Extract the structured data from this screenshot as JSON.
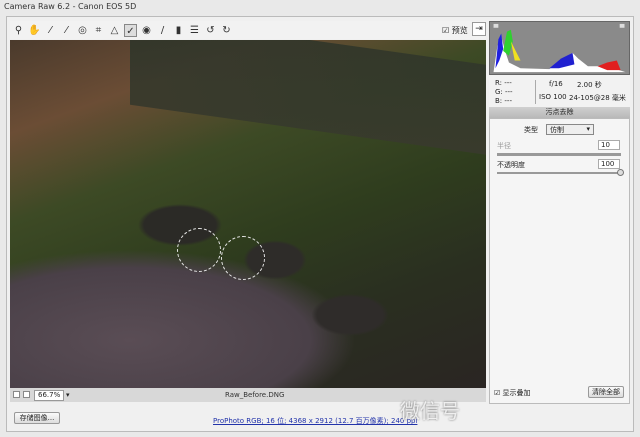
{
  "window": {
    "title": "Camera Raw 6.2 - Canon EOS 5D"
  },
  "toolbar": {
    "tools": [
      "zoom-icon",
      "hand-icon",
      "white-balance-icon",
      "color-sampler-icon",
      "target-adjust-icon",
      "crop-icon",
      "straighten-icon",
      "spot-removal-icon",
      "red-eye-icon",
      "adjustment-brush-icon",
      "graduated-filter-icon",
      "preferences-icon",
      "rotate-ccw-icon",
      "rotate-cw-icon"
    ],
    "active_tool": "spot-removal-icon",
    "preview_label": "预览",
    "preview_checked": true
  },
  "info": {
    "r": "R: ---",
    "g": "G: ---",
    "b": "B: ---",
    "aperture": "f/16",
    "shutter": "2.00 秒",
    "iso": "ISO 100",
    "lens": "24-105@28 毫米"
  },
  "panel": {
    "title": "污点去除",
    "type_label": "类型",
    "type_value": "仿制",
    "radius_label": "半径",
    "radius_value": "10",
    "opacity_label": "不透明度",
    "opacity_value": "100",
    "radius_fraction": 0.1,
    "opacity_fraction": 1.0,
    "overlay_label": "显示叠加",
    "overlay_checked": true,
    "clear_all": "清除全部"
  },
  "status": {
    "zoom": "66.7%",
    "filename": "Raw_Before.DNG"
  },
  "footer": {
    "save_button": "存储图像...",
    "workflow_link": "ProPhoto RGB; 16 位; 4368 x 2912 (12.7 百万像素); 240 ppi"
  },
  "watermark": "微信号"
}
